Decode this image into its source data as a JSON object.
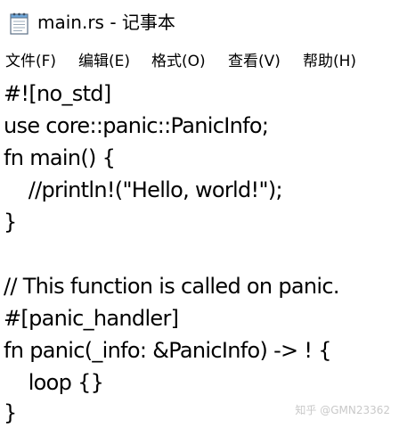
{
  "window": {
    "title": "main.rs - 记事本",
    "icon": "notepad-icon"
  },
  "menu": {
    "items": [
      {
        "label": "文件(F)"
      },
      {
        "label": "编辑(E)"
      },
      {
        "label": "格式(O)"
      },
      {
        "label": "查看(V)"
      },
      {
        "label": "帮助(H)"
      }
    ]
  },
  "editor": {
    "lines": [
      "#![no_std]",
      "use core::panic::PanicInfo;",
      "fn main() {",
      "    //println!(\"Hello, world!\");",
      "}",
      "",
      "// This function is called on panic.",
      "#[panic_handler]",
      "fn panic(_info: &PanicInfo) -> ! {",
      "    loop {}",
      "}"
    ]
  },
  "watermark": {
    "text": "知乎 @GMN23362"
  }
}
